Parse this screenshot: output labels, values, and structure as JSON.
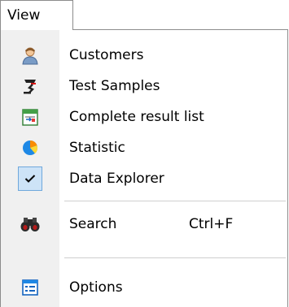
{
  "menubar": {
    "title": "View"
  },
  "menu": {
    "items": [
      {
        "label": "Customers",
        "icon": "customer-person-icon"
      },
      {
        "label": "Test Samples",
        "icon": "test-sample-icon"
      },
      {
        "label": "Complete result list",
        "icon": "result-list-icon"
      },
      {
        "label": "Statistic",
        "icon": "pie-chart-icon"
      },
      {
        "label": "Data Explorer",
        "icon": "checkmark-icon",
        "checked": true
      },
      {
        "label": "Search",
        "icon": "binoculars-icon",
        "shortcut": "Ctrl+F"
      },
      {
        "label": "Options",
        "icon": "options-list-icon"
      }
    ]
  },
  "colors": {
    "accent_check_bg": "#cde3f7",
    "accent_check_border": "#6fa8dc",
    "separator": "#cfcfcf",
    "icon_strip": "#f0f0f0"
  }
}
